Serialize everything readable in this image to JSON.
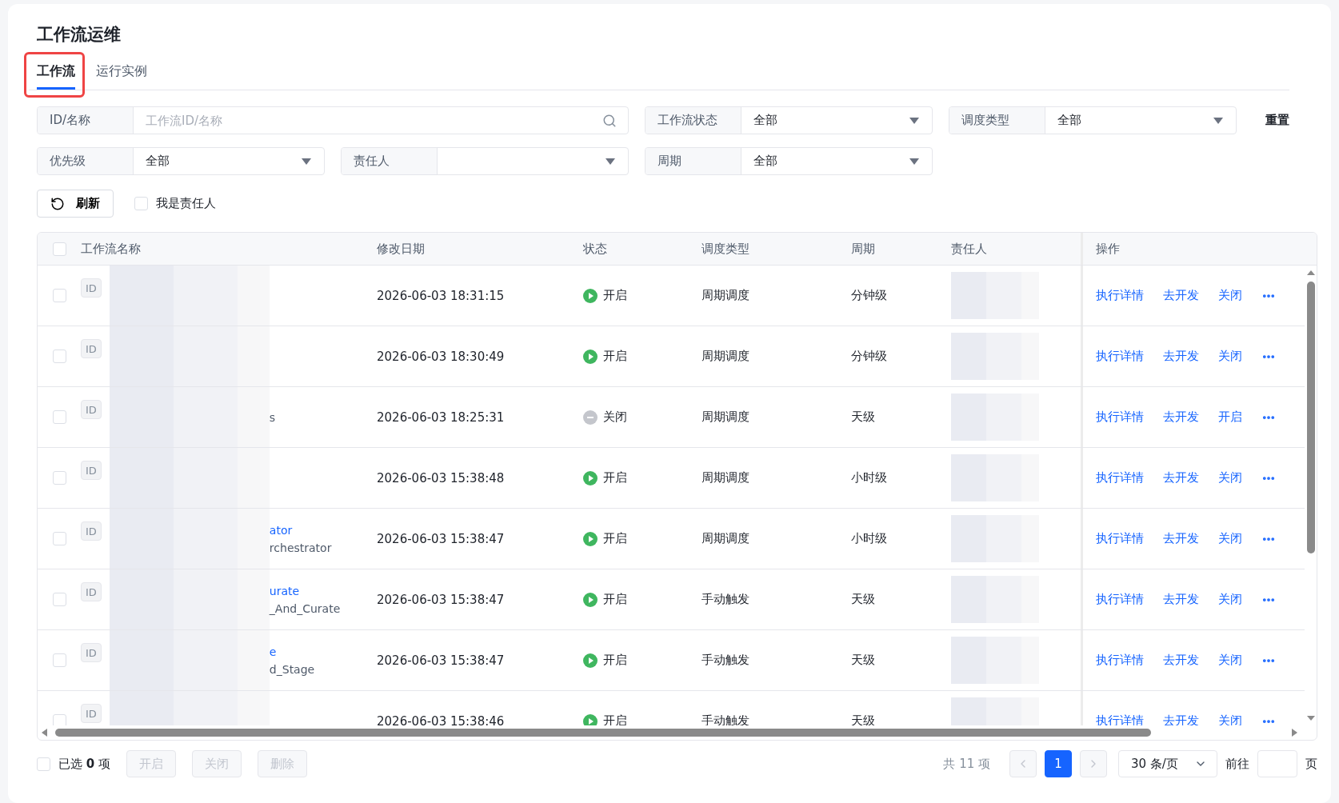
{
  "title": "工作流运维",
  "tabs": [
    {
      "label": "工作流",
      "selected": true,
      "highlighted": true
    },
    {
      "label": "运行实例",
      "selected": false,
      "highlighted": false
    }
  ],
  "filters": [
    {
      "kind": "search",
      "label": "ID/名称",
      "placeholder": "工作流ID/名称"
    },
    {
      "kind": "select",
      "label": "工作流状态",
      "value": "全部"
    },
    {
      "kind": "select",
      "label": "调度类型",
      "value": "全部"
    },
    {
      "kind": "select",
      "label": "优先级",
      "value": "全部"
    },
    {
      "kind": "select",
      "label": "责任人"
    },
    {
      "kind": "select",
      "label": "周期",
      "value": "全部"
    }
  ],
  "reset": "重置",
  "refresh": "刷新",
  "mine": {
    "label": "我是责任人",
    "checked": false
  },
  "table": {
    "all_checked": false,
    "columns": [
      "工作流名称",
      "修改日期",
      "状态",
      "调度类型",
      "周期",
      "责任人",
      "操作"
    ],
    "rows": [
      {
        "checked": false,
        "badge": "ID",
        "modified": "2026-06-03 18:31:15",
        "status": {
          "label": "开启",
          "on": true
        },
        "schedule": "周期调度",
        "period": "分钟级",
        "actions": [
          "执行详情",
          "去开发",
          "关闭"
        ]
      },
      {
        "checked": false,
        "badge": "ID",
        "modified": "2026-06-03 18:30:49",
        "status": {
          "label": "开启",
          "on": true
        },
        "schedule": "周期调度",
        "period": "分钟级",
        "actions": [
          "执行详情",
          "去开发",
          "关闭"
        ]
      },
      {
        "checked": false,
        "badge": "ID",
        "subname": "s",
        "modified": "2026-06-03 18:25:31",
        "status": {
          "label": "关闭",
          "on": false
        },
        "schedule": "周期调度",
        "period": "天级",
        "actions": [
          "执行详情",
          "去开发",
          "开启"
        ]
      },
      {
        "checked": false,
        "badge": "ID",
        "modified": "2026-06-03 15:38:48",
        "status": {
          "label": "开启",
          "on": true
        },
        "schedule": "周期调度",
        "period": "小时级",
        "actions": [
          "执行详情",
          "去开发",
          "关闭"
        ]
      },
      {
        "checked": false,
        "badge": "ID",
        "name": "ator",
        "subname": "rchestrator",
        "modified": "2026-06-03 15:38:47",
        "status": {
          "label": "开启",
          "on": true
        },
        "schedule": "周期调度",
        "period": "小时级",
        "actions": [
          "执行详情",
          "去开发",
          "关闭"
        ]
      },
      {
        "checked": false,
        "badge": "ID",
        "name": "urate",
        "subname": "_And_Curate",
        "modified": "2026-06-03 15:38:47",
        "status": {
          "label": "开启",
          "on": true
        },
        "schedule": "手动触发",
        "period": "天级",
        "actions": [
          "执行详情",
          "去开发",
          "关闭"
        ]
      },
      {
        "checked": false,
        "badge": "ID",
        "name": "e",
        "subname": "d_Stage",
        "modified": "2026-06-03 15:38:47",
        "status": {
          "label": "开启",
          "on": true
        },
        "schedule": "手动触发",
        "period": "天级",
        "actions": [
          "执行详情",
          "去开发",
          "关闭"
        ]
      },
      {
        "checked": false,
        "badge": "ID",
        "modified": "2026-06-03 15:38:46",
        "status": {
          "label": "开启",
          "on": true
        },
        "schedule": "手动触发",
        "period": "天级",
        "actions": [
          "执行详情",
          "去开发",
          "关闭"
        ]
      }
    ]
  },
  "footer": {
    "select_all": {
      "checked": false
    },
    "selected_label": "已选 **0** 项",
    "bulk_buttons": [
      {
        "label": "开启",
        "disabled": true
      },
      {
        "label": "关闭",
        "disabled": true
      },
      {
        "label": "删除",
        "disabled": true
      }
    ],
    "total": "共 11 项",
    "pages": [
      {
        "label": "1",
        "selected": true
      }
    ],
    "page_size": "30 条/页",
    "goto": "前往",
    "page_unit": "页"
  }
}
